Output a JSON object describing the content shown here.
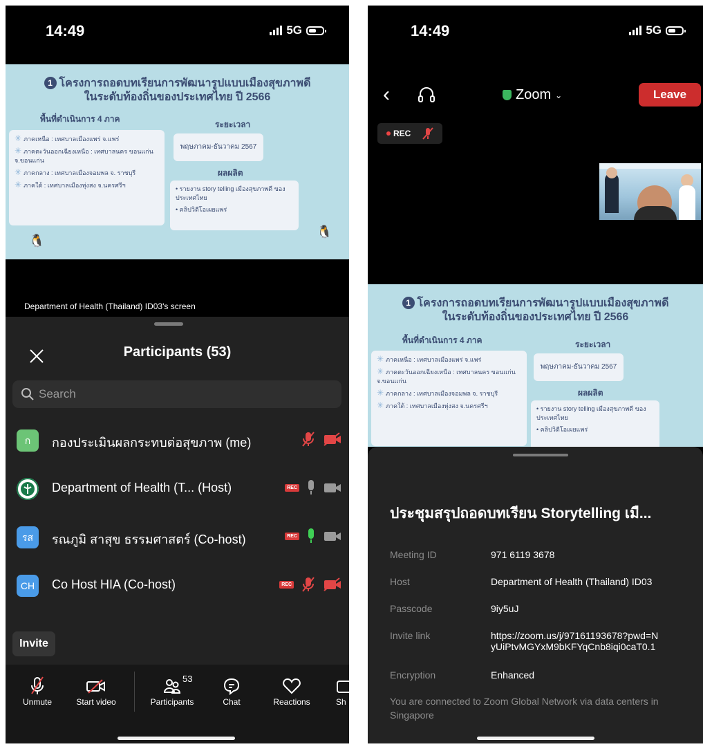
{
  "left": {
    "status": {
      "time": "14:49",
      "network": "5G"
    },
    "slide": {
      "number": "1",
      "title_line1": "โครงการถอดบทเรียนการพัฒนารูปแบบเมืองสุขภาพดี",
      "title_line2": "ในระดับท้องถิ่นของประเทศไทย ปี 2566",
      "areas_heading": "พื้นที่ดำเนินการ 4 ภาค",
      "areas": [
        "ภาคเหนือ : เทศบาลเมืองแพร่ จ.แพร่",
        "ภาคตะวันออกเฉียงเหนือ : เทศบาลนคร ขอนแก่น จ.ขอนแก่น",
        "ภาคกลาง : เทศบาลเมืองจอมพล จ. ราชบุรี",
        "ภาคใต้ : เทศบาลเมืองทุ่งสง จ.นครศรีฯ"
      ],
      "period_heading": "ระยะเวลา",
      "period": "พฤษภาคม-ธันวาคม 2567",
      "output_heading": "ผลผลิต",
      "outputs": [
        "• รายงาน story telling เมืองสุขภาพดี ของประเทศไทย",
        "• คลิปวิดีโอเผยแพร่"
      ]
    },
    "share_caption": "Department of Health (Thailand) ID03's screen",
    "participants": {
      "title": "Participants (53)",
      "search_placeholder": "Search",
      "rows": [
        {
          "initials": "ก",
          "name": "กองประเมินผลกระทบต่อสุขภาพ (me)",
          "avatar_color": "#6cc476"
        },
        {
          "initials": "",
          "name": "Department of Health (T...  (Host)",
          "avatar_color": "#ffffff"
        },
        {
          "initials": "รส",
          "name": "รณภูมิ สาสุข ธรรมศาสตร์ (Co-host)",
          "avatar_color": "#4a9be8"
        },
        {
          "initials": "CH",
          "name": "Co Host HIA (Co-host)",
          "avatar_color": "#4a9be8"
        }
      ],
      "rec_badge": "REC",
      "invite_label": "Invite"
    },
    "toolbar": {
      "unmute": "Unmute",
      "start_video": "Start video",
      "participants": "Participants",
      "participants_count": "53",
      "chat": "Chat",
      "reactions": "Reactions",
      "share_partial": "Sh"
    }
  },
  "right": {
    "status": {
      "time": "14:49",
      "network": "5G"
    },
    "app_title": "Zoom",
    "leave_label": "Leave",
    "rec_label": "REC",
    "meeting": {
      "title": "ประชุมสรุปถอดบทเรียน Storytelling เมื...",
      "id_label": "Meeting ID",
      "id_value": "971 6119 3678",
      "host_label": "Host",
      "host_value": "Department of Health (Thailand) ID03",
      "passcode_label": "Passcode",
      "passcode_value": "9iy5uJ",
      "invite_label": "Invite link",
      "invite_line1": "https://zoom.us/j/97161193678?pwd=N",
      "invite_line2": "yUiPtvMGYxM9bKFYqCnb8iqi0caT0.1",
      "encryption_label": "Encryption",
      "encryption_value": "Enhanced",
      "network_note": "You are connected to Zoom Global Network via data centers in Singapore"
    }
  }
}
